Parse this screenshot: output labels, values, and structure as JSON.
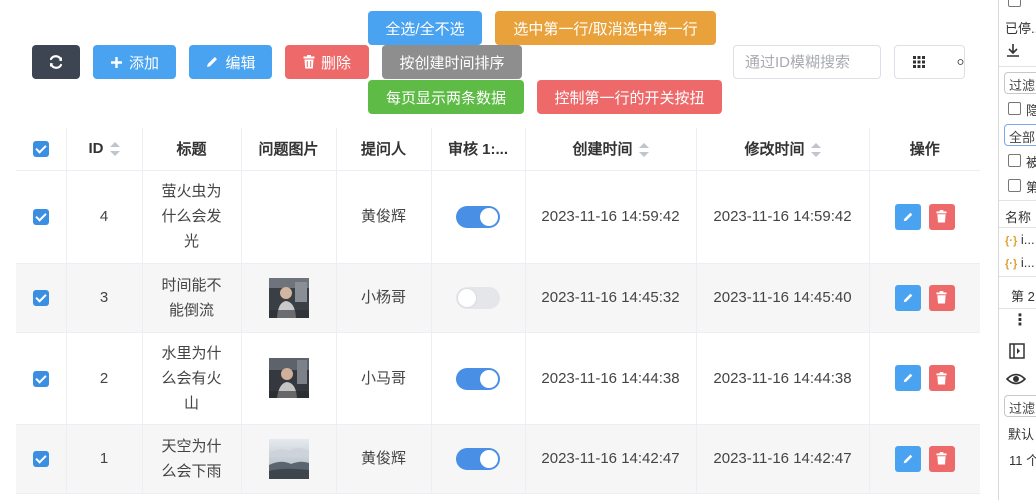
{
  "toolbar": {
    "add_label": "添加",
    "edit_label": "编辑",
    "delete_label": "删除",
    "sort_label": "按创建时间排序",
    "select_all_label": "全选/全不选",
    "select_first_label": "选中第一行/取消选中第一行",
    "page_two_label": "每页显示两条数据",
    "toggle_first_label": "控制第一行的开关按扭",
    "search_placeholder": "通过ID模糊搜索",
    "search_value": ""
  },
  "table": {
    "columns": [
      "ID",
      "标题",
      "问题图片",
      "提问人",
      "审核 1:...",
      "创建时间",
      "修改时间",
      "操作"
    ],
    "rows": [
      {
        "checked": true,
        "id": "4",
        "title": "萤火虫为什么会发光",
        "has_image": false,
        "asker": "黄俊辉",
        "approved": true,
        "created": "2023-11-16 14:59:42",
        "modified": "2023-11-16 14:59:42"
      },
      {
        "checked": true,
        "id": "3",
        "title": "时间能不能倒流",
        "has_image": true,
        "asker": "小杨哥",
        "approved": false,
        "created": "2023-11-16 14:45:32",
        "modified": "2023-11-16 14:45:40"
      },
      {
        "checked": true,
        "id": "2",
        "title": "水里为什么会有火山",
        "has_image": true,
        "asker": "小马哥",
        "approved": true,
        "created": "2023-11-16 14:44:38",
        "modified": "2023-11-16 14:44:38"
      },
      {
        "checked": true,
        "id": "1",
        "title": "天空为什么会下雨",
        "has_image": true,
        "asker": "黄俊辉",
        "approved": true,
        "created": "2023-11-16 14:42:47",
        "modified": "2023-11-16 14:42:47"
      }
    ]
  },
  "side_panel": {
    "stopped_label": "已停...",
    "filter_placeholder_1": "过滤",
    "check_1": "隐",
    "all_label": "全部",
    "check_2": "被",
    "check_3": "第",
    "name_header": "名称",
    "req_1": "i...",
    "req_2": "i...",
    "page_label": "第 2",
    "filter_placeholder_2": "过滤",
    "default_label": "默认",
    "count_label": "11 个"
  },
  "colors": {
    "primary": "#4aa3f0",
    "danger": "#ee6a6a",
    "dark": "#3d4452",
    "gray": "#8e8e8e",
    "orange": "#e9a23b",
    "green": "#5dbb46",
    "switch_on": "#4a8fe6"
  }
}
